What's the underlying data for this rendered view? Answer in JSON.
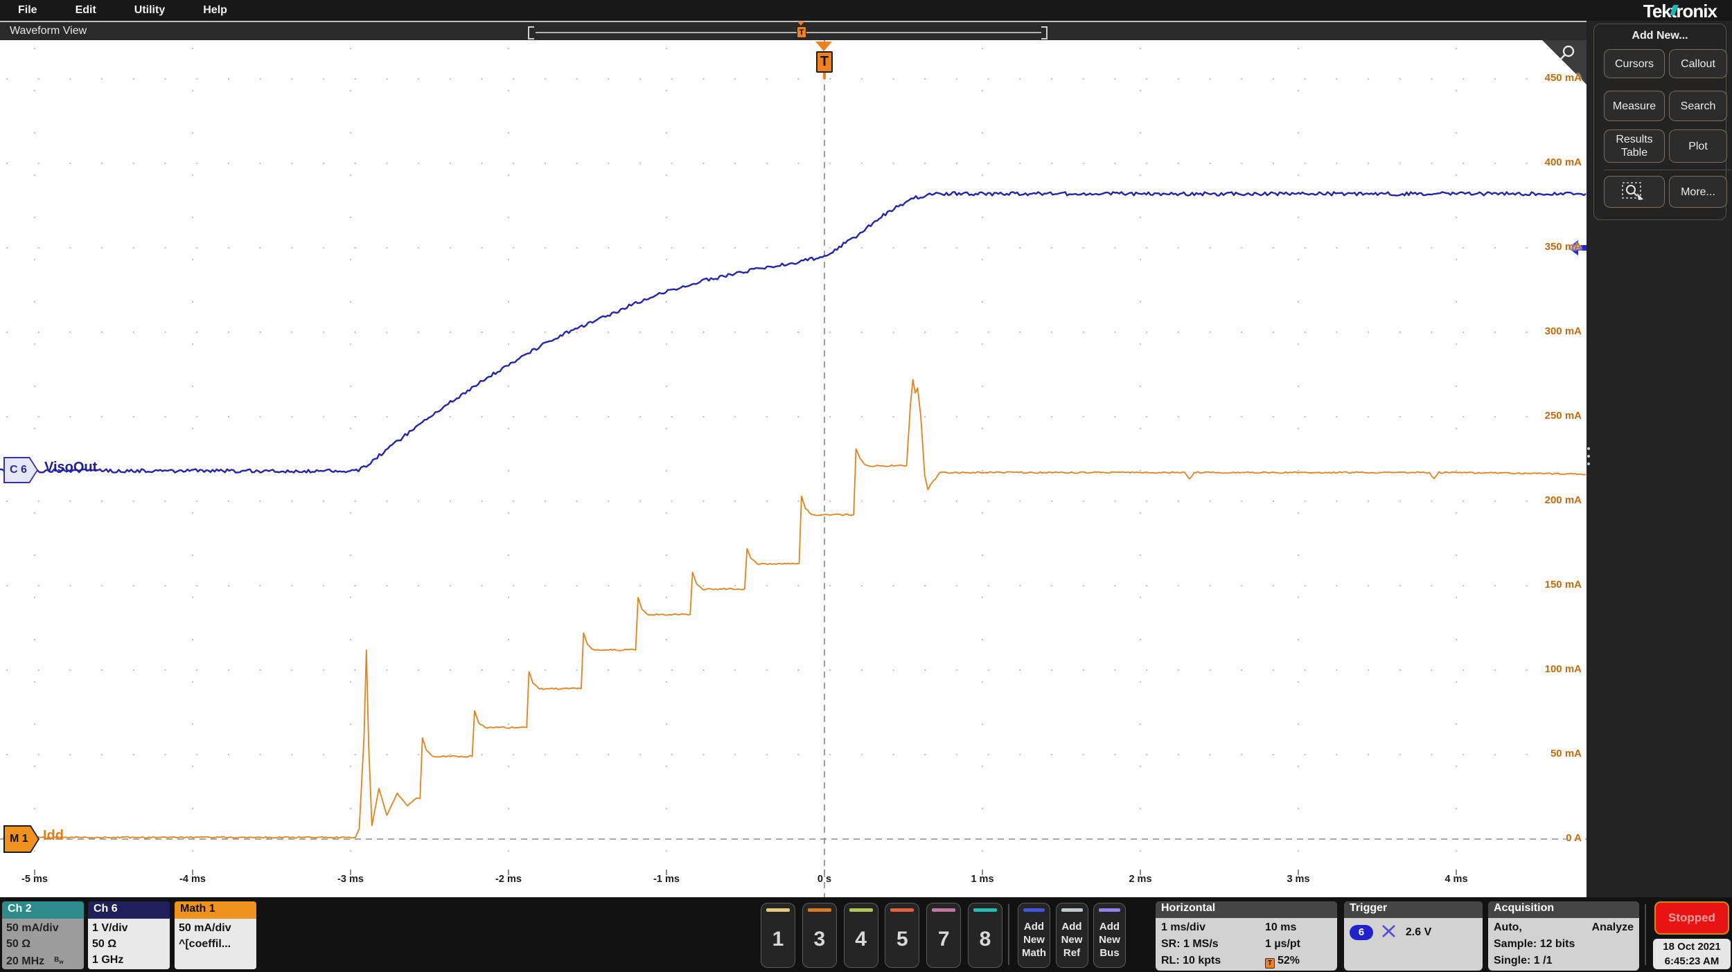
{
  "menu": {
    "items": [
      "File",
      "Edit",
      "Utility",
      "Help"
    ]
  },
  "brand": "Tektronix",
  "window_title": "Waveform View",
  "sidebar": {
    "header": "Add New...",
    "button_rows": [
      [
        "Cursors",
        "Callout"
      ],
      [
        "Measure",
        "Search"
      ],
      [
        "Results Table",
        "Plot"
      ]
    ],
    "zoom_tool_icon": "zoom-select-icon",
    "more_label": "More..."
  },
  "waveform_labels": {
    "ch6_badge": "C 6",
    "ch6_trace_name": "VisoOut",
    "math_badge": "M 1",
    "math_trace_name": "Idd",
    "trigger_glyph": "T"
  },
  "y_axis": {
    "unit": "mA",
    "values": [
      450,
      400,
      350,
      300,
      250,
      200,
      150,
      100,
      50,
      0
    ],
    "labels": [
      "450 mA",
      "400 mA",
      "350 mA",
      "300 mA",
      "250 mA",
      "200 mA",
      "150 mA",
      "100 mA",
      "50 mA",
      "0 A"
    ]
  },
  "x_axis": {
    "values": [
      -5,
      -4,
      -3,
      -2,
      -1,
      0,
      1,
      2,
      3,
      4
    ],
    "labels": [
      "-5 ms",
      "-4 ms",
      "-3 ms",
      "-2 ms",
      "-1 ms",
      "0 s",
      "1 ms",
      "2 ms",
      "3 ms",
      "4 ms"
    ]
  },
  "channel_badges": [
    {
      "name": "Ch 2",
      "header_color": "#2e8b8b",
      "header_text": "#ffffff",
      "body_color": "#9c9c9c",
      "text_color": "#222222",
      "lines": [
        "50 mA/div",
        "50 Ω",
        "20 MHz"
      ],
      "bw_tag": true
    },
    {
      "name": "Ch 6",
      "header_color": "#20205c",
      "header_text": "#ffffff",
      "body_color": "#e9e9e9",
      "text_color": "#111111",
      "lines": [
        "1 V/div",
        "50 Ω",
        "1 GHz"
      ],
      "bw_tag": false
    },
    {
      "name": "Math 1",
      "header_color": "#f0921e",
      "header_text": "#111111",
      "body_color": "#e9e9e9",
      "text_color": "#111111",
      "lines": [
        "50 mA/div",
        "^[coeffil..."
      ],
      "bw_tag": false
    }
  ],
  "scope_buttons": [
    {
      "label": "1",
      "color": "#e9c87c"
    },
    {
      "label": "3",
      "color": "#e07820"
    },
    {
      "label": "4",
      "color": "#b2c654"
    },
    {
      "label": "5",
      "color": "#e2603c"
    },
    {
      "label": "7",
      "color": "#c578a2"
    },
    {
      "label": "8",
      "color": "#21bfb2"
    }
  ],
  "add_buttons": [
    {
      "label": "Add New Math",
      "color": "#4452e2"
    },
    {
      "label": "Add New Ref",
      "color": "#c2cace"
    },
    {
      "label": "Add New Bus",
      "color": "#9382ea"
    }
  ],
  "horizontal_panel": {
    "title": "Horizontal",
    "rows": [
      [
        "1 ms/div",
        "10 ms"
      ],
      [
        "SR: 1 MS/s",
        "1 µs/pt"
      ],
      [
        "RL: 10 kpts",
        "52%"
      ]
    ],
    "trigger_position_row": 2
  },
  "trigger_panel": {
    "title": "Trigger",
    "source": "6",
    "level": "2.6 V"
  },
  "acquisition_panel": {
    "title": "Acquisition",
    "row1_left": "Auto,",
    "row1_right": "Analyze",
    "row2": "Sample: 12 bits",
    "row3": "Single: 1 /1"
  },
  "status": {
    "run_state": "Stopped",
    "date": "18 Oct 2021",
    "time": "6:45:23 AM"
  },
  "chart_data": {
    "type": "line",
    "x_unit": "ms",
    "y_unit": "mA",
    "x_range": [
      -5.22,
      4.82
    ],
    "y_range": [
      -17,
      472
    ],
    "trigger_time_ms": 0,
    "trigger_position_pct": 52,
    "grid": "dotted",
    "series": [
      {
        "name": "Idd (Math 1)",
        "color": "#e0831c",
        "width": 1.8,
        "noise": 1.1,
        "points": [
          [
            -5.2,
            1
          ],
          [
            -2.97,
            1
          ],
          [
            -2.945,
            6
          ],
          [
            -2.915,
            60
          ],
          [
            -2.9,
            112
          ],
          [
            -2.885,
            55
          ],
          [
            -2.865,
            8
          ],
          [
            -2.82,
            30
          ],
          [
            -2.77,
            14
          ],
          [
            -2.705,
            27
          ],
          [
            -2.64,
            20
          ],
          [
            -2.58,
            24
          ],
          [
            -2.56,
            24
          ],
          [
            -2.545,
            60
          ],
          [
            -2.52,
            53
          ],
          [
            -2.48,
            49
          ],
          [
            -2.23,
            49
          ],
          [
            -2.215,
            76
          ],
          [
            -2.19,
            69
          ],
          [
            -2.15,
            66
          ],
          [
            -1.885,
            66
          ],
          [
            -1.87,
            99
          ],
          [
            -1.845,
            92
          ],
          [
            -1.805,
            89
          ],
          [
            -1.54,
            89
          ],
          [
            -1.525,
            122
          ],
          [
            -1.5,
            115
          ],
          [
            -1.46,
            112
          ],
          [
            -1.195,
            112
          ],
          [
            -1.18,
            143
          ],
          [
            -1.155,
            136
          ],
          [
            -1.115,
            133
          ],
          [
            -0.85,
            133
          ],
          [
            -0.835,
            158
          ],
          [
            -0.81,
            151
          ],
          [
            -0.77,
            148
          ],
          [
            -0.505,
            148
          ],
          [
            -0.49,
            172
          ],
          [
            -0.465,
            166
          ],
          [
            -0.425,
            163
          ],
          [
            -0.16,
            163
          ],
          [
            -0.145,
            203
          ],
          [
            -0.12,
            196
          ],
          [
            -0.08,
            192
          ],
          [
            0.185,
            192
          ],
          [
            0.2,
            231
          ],
          [
            0.225,
            225
          ],
          [
            0.265,
            221
          ],
          [
            0.52,
            221
          ],
          [
            0.545,
            258
          ],
          [
            0.56,
            272
          ],
          [
            0.575,
            264
          ],
          [
            0.59,
            267
          ],
          [
            0.61,
            250
          ],
          [
            0.635,
            215
          ],
          [
            0.655,
            207
          ],
          [
            0.69,
            212
          ],
          [
            0.73,
            217
          ],
          [
            2.28,
            217
          ],
          [
            2.31,
            213
          ],
          [
            2.34,
            217
          ],
          [
            3.83,
            217
          ],
          [
            3.86,
            213
          ],
          [
            3.89,
            217
          ],
          [
            4.82,
            216
          ]
        ]
      },
      {
        "name": "VisoOut (Ch 6)",
        "color": "#2424aa",
        "width": 2.4,
        "noise": 2.6,
        "points": [
          [
            -5.22,
            218
          ],
          [
            -2.95,
            218
          ],
          [
            -2.9,
            221
          ],
          [
            -2.6,
            243
          ],
          [
            -2.3,
            263
          ],
          [
            -2.0,
            281
          ],
          [
            -1.7,
            297
          ],
          [
            -1.4,
            309
          ],
          [
            -1.1,
            321
          ],
          [
            -0.8,
            330
          ],
          [
            -0.5,
            336
          ],
          [
            -0.2,
            341
          ],
          [
            0.0,
            345
          ],
          [
            0.2,
            357
          ],
          [
            0.4,
            371
          ],
          [
            0.55,
            379
          ],
          [
            0.68,
            382
          ],
          [
            4.82,
            382
          ]
        ]
      }
    ]
  }
}
